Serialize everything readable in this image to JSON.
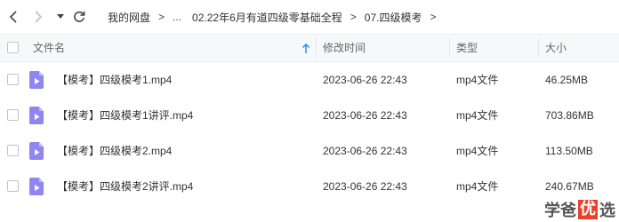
{
  "breadcrumb": {
    "items": [
      "我的网盘",
      "...",
      "02.22年6月有道四级零基础全程",
      "07.四级模考"
    ],
    "separator": ">"
  },
  "table": {
    "columns": [
      "文件名",
      "修改时间",
      "类型",
      "大小"
    ],
    "rows": [
      {
        "name": "【模考】四级模考1.mp4",
        "time": "2023-06-26 22:43",
        "type": "mp4文件",
        "size": "46.25MB"
      },
      {
        "name": "【模考】四级模考1讲评.mp4",
        "time": "2023-06-26 22:43",
        "type": "mp4文件",
        "size": "703.86MB"
      },
      {
        "name": "【模考】四级模考2.mp4",
        "time": "2023-06-26 22:43",
        "type": "mp4文件",
        "size": "113.50MB"
      },
      {
        "name": "【模考】四级模考2讲评.mp4",
        "time": "2023-06-26 22:43",
        "type": "mp4文件",
        "size": "240.67MB"
      }
    ]
  },
  "watermark": {
    "pre": "学爸",
    "mid": "优",
    "post": "选"
  },
  "icons": {
    "back": "chevron-left-icon",
    "forward": "chevron-right-icon",
    "dropdown": "caret-down-icon",
    "refresh": "refresh-icon",
    "sort": "sort-arrow-up-icon",
    "file": "video-file-icon"
  },
  "colors": {
    "file_icon": "#8f86f0",
    "sort_arrow": "#1a8cff",
    "watermark_accent": "#e8412c"
  }
}
